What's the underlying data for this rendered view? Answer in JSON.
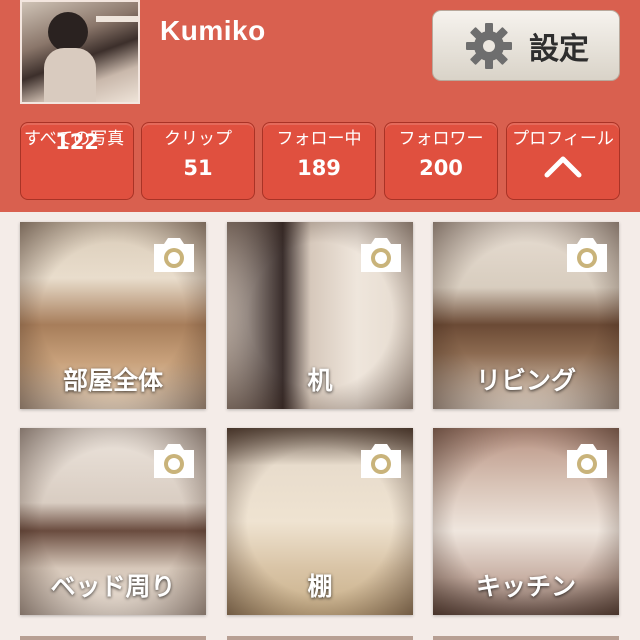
{
  "profile": {
    "username": "Kumiko",
    "settings_label": "設定"
  },
  "stats": [
    {
      "label": "すべての写真",
      "value": "122"
    },
    {
      "label": "クリップ",
      "value": "51"
    },
    {
      "label": "フォロー中",
      "value": "189"
    },
    {
      "label": "フォロワー",
      "value": "200"
    },
    {
      "label": "プロフィール",
      "icon": "chevron-up-icon"
    }
  ],
  "categories": [
    {
      "label": "部屋全体",
      "icon": "camera-icon"
    },
    {
      "label": "机",
      "icon": "camera-icon"
    },
    {
      "label": "リビング",
      "icon": "camera-icon"
    },
    {
      "label": "ベッド周り",
      "icon": "camera-icon"
    },
    {
      "label": "棚",
      "icon": "camera-icon"
    },
    {
      "label": "キッチン",
      "icon": "camera-icon"
    }
  ],
  "colors": {
    "header": "#d9604f",
    "stat_button": "#e0503f",
    "background": "#f4ece8"
  }
}
